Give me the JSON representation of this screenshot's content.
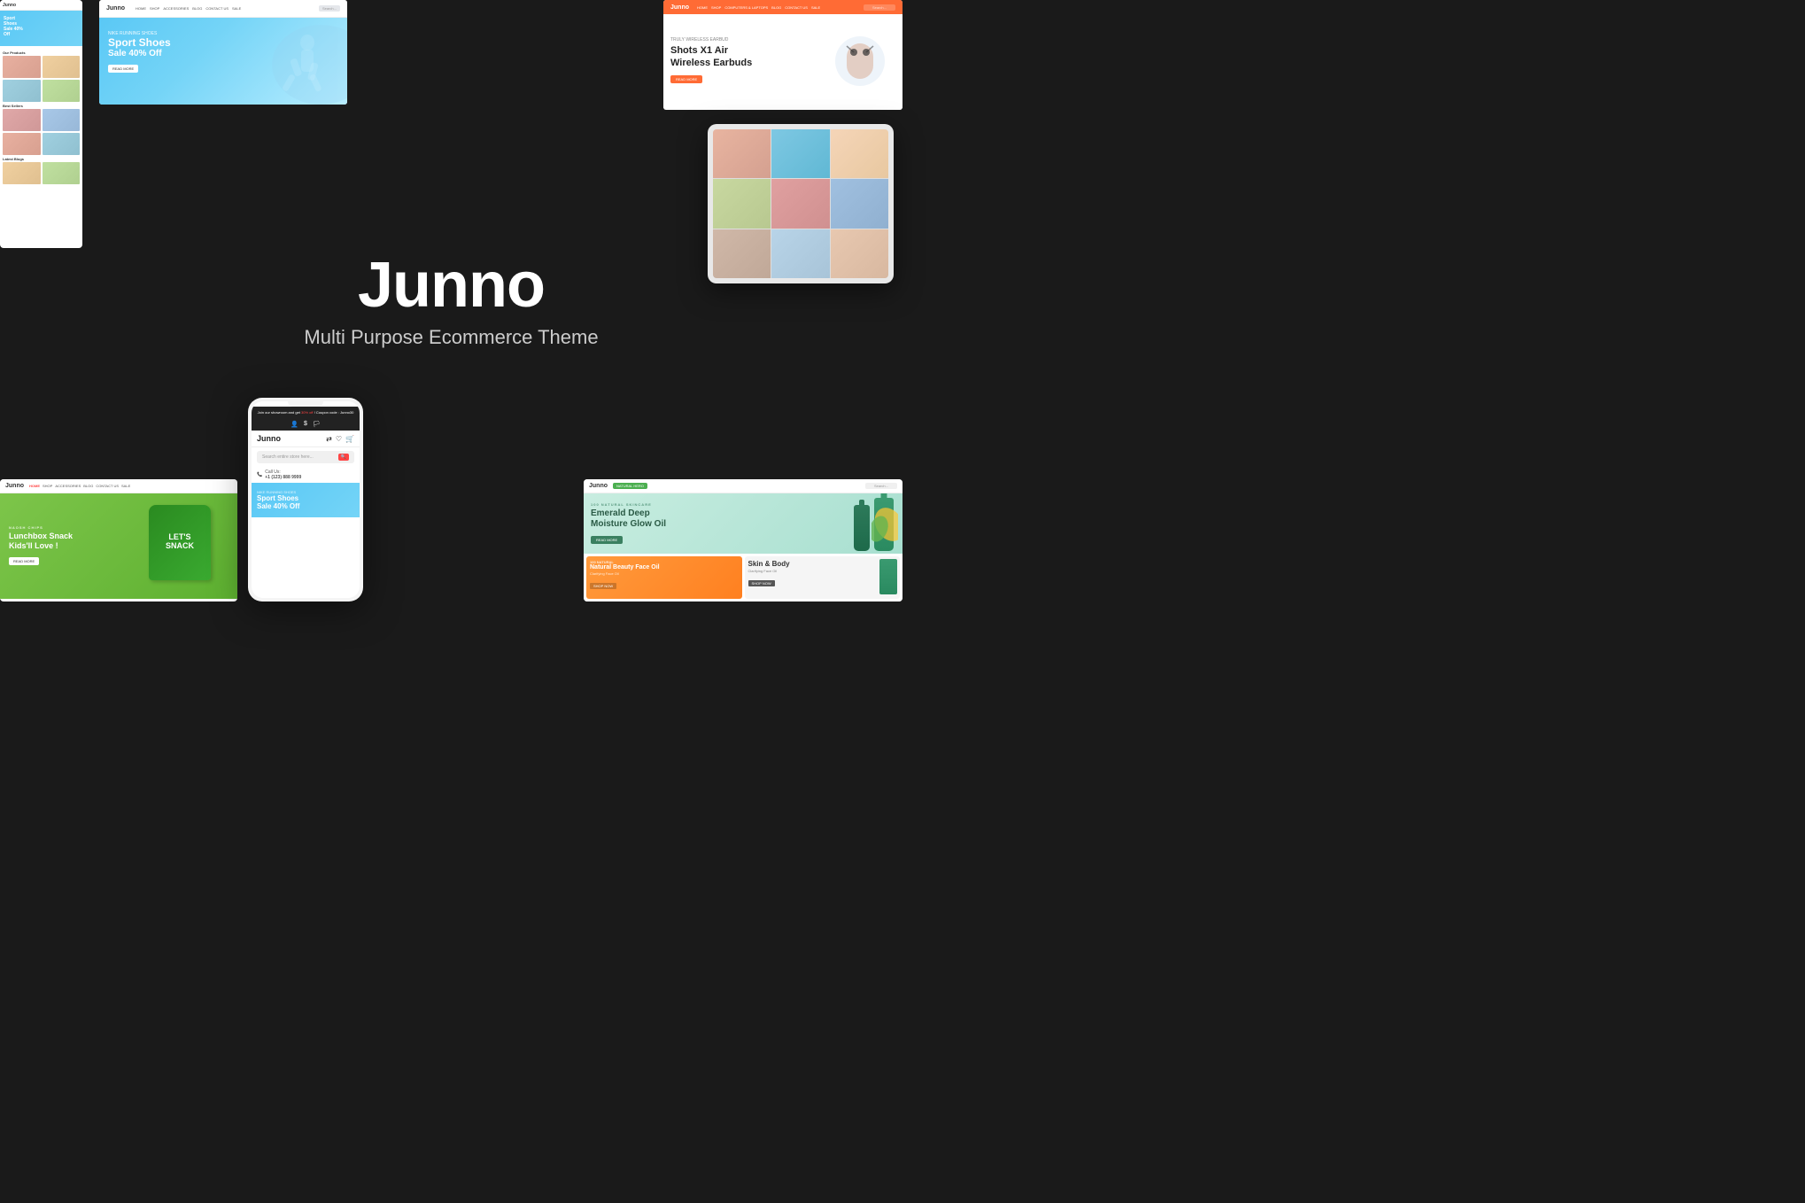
{
  "page": {
    "background": "#1a1a1a",
    "title": "Junno",
    "subtitle": "Multi Purpose Ecommerce Theme"
  },
  "panels": {
    "sport": {
      "logo": "Junno",
      "nav": [
        "HOME",
        "SHOP",
        "ACCESSORIES",
        "BLOG",
        "CONTACT US",
        "SALE"
      ],
      "hero_label": "NIKE RUNNING SHOES",
      "hero_title": "Sport Shoes",
      "hero_sale": "Sale 40% Off",
      "hero_btn": "READ MORE"
    },
    "earbuds": {
      "logo": "Junno",
      "nav": [
        "HOME",
        "SHOP",
        "COMPUTERS & LAPTOPS",
        "BLOG",
        "CONTACT US",
        "SALE"
      ],
      "hero_label": "TRULY WIRELESS EARBUD",
      "hero_title": "Shots X1 Air\nWireless Earbuds",
      "hero_btn": "READ MORE"
    },
    "food": {
      "logo": "Junno",
      "nav": [
        "HOME",
        "SHOP",
        "ACCESSORIES",
        "BLOG",
        "CONTACT US",
        "SALE"
      ],
      "hero_label": "NAOSH CHIPS",
      "hero_title": "Lunchbox Snack\nKids'll Love !",
      "snack_title": "LET'S\nSNACK",
      "hero_btn": "READ MORE"
    },
    "phone": {
      "logo": "Junno",
      "banner": "Join our showroom and get 30% off ! Coupon code : Junno30",
      "search_placeholder": "Search entire store here...",
      "call_label": "Call Us:",
      "call_number": "+1 (123) 888 9999",
      "hero_label": "NIKE RUNNING SHOES",
      "hero_title": "Sport Shoes\nSale 40% Off"
    },
    "skincare": {
      "logo": "Junno",
      "nav_active": "NATURAL HERO",
      "hero_label": "100 NATURAL SKINCARE",
      "hero_title": "Emerald Deep\nMoisture Glow Oil",
      "hero_btn": "READ MORE",
      "card1_label": "100 NATURAL",
      "card1_title": "Natural Beauty\nFace Oil",
      "card1_subtitle": "Clarifying Face Oil",
      "card1_btn": "SHOP NOW",
      "card2_title": "Skin & Body",
      "card2_subtitle": "Clarifying Face Oil",
      "card2_btn": "SHOP NOW"
    }
  },
  "mobile_left": {
    "logo": "Junno",
    "hero_text": "Sport Shoes\nSale 40%\nOff",
    "section1": "Our Products",
    "section2": "Best Sellers",
    "section3": "Latest Blogs"
  }
}
